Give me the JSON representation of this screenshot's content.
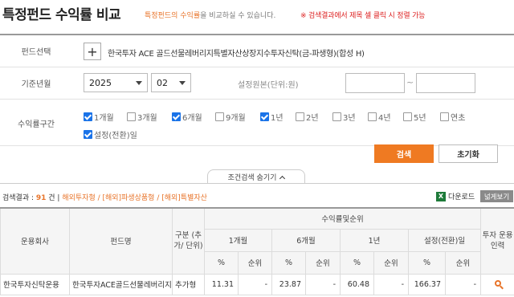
{
  "header": {
    "title": "특정펀드 수익률 비교",
    "subtitle_highlight": "특정펀드의 수익률",
    "subtitle_rest": "을 비교하실 수 있습니다.",
    "warning": "※ 검색결과에서 제목 셀 클릭 시 정렬 가능"
  },
  "form": {
    "fund_select_label": "펀드선택",
    "fund_add_icon": "plus-icon",
    "fund_name": "한국투자 ACE 골드선물레버리지특별자산상장지수투자신탁(금-파생형)(합성 H)",
    "base_month_label": "기준년월",
    "year": "2025",
    "month": "02",
    "setup_amount_label": "설정원본(단위:원)",
    "setup_from": "",
    "setup_to": "",
    "range_separator": "~",
    "return_period_label": "수익률구간",
    "periods": [
      {
        "label": "1개월",
        "checked": true
      },
      {
        "label": "3개월",
        "checked": false
      },
      {
        "label": "6개월",
        "checked": true
      },
      {
        "label": "9개월",
        "checked": false
      },
      {
        "label": "1년",
        "checked": true
      },
      {
        "label": "2년",
        "checked": false
      },
      {
        "label": "3년",
        "checked": false
      },
      {
        "label": "4년",
        "checked": false
      },
      {
        "label": "5년",
        "checked": false
      },
      {
        "label": "연초",
        "checked": false
      },
      {
        "label": "설정(전환)일",
        "checked": true
      }
    ],
    "search_button": "검색",
    "reset_button": "초기화",
    "toggle_label": "조건검색 숨기기"
  },
  "results": {
    "prefix": "검색결과 : ",
    "count": "91",
    "unit": "건",
    "categories": "해외투자형 / [해외]파생상품형 / [해외]특별자산",
    "download_label": "다운로드",
    "wide_view_label": "넓게보기"
  },
  "table": {
    "headers": {
      "company": "운용회사",
      "fund": "펀드명",
      "type": "구분 (추가/ 단위)",
      "return_group": "수익률및순위",
      "periods": [
        "1개월",
        "6개월",
        "1년",
        "설정(전환)일"
      ],
      "pct": "%",
      "rank": "순위",
      "invest_info": "투자 운용 인력"
    },
    "rows": [
      {
        "company": "한국투자신탁운용",
        "fund": "한국투자ACE골드선물레버리지",
        "type": "추가형",
        "m1": "11.31",
        "m1_rank": "-",
        "m6": "23.87",
        "m6_rank": "-",
        "y1": "60.48",
        "y1_rank": "-",
        "since": "166.37",
        "since_rank": "-"
      }
    ]
  },
  "colors": {
    "accent": "#ef7a22",
    "warning": "#dd2222",
    "checkbox": "#1a73e8"
  }
}
